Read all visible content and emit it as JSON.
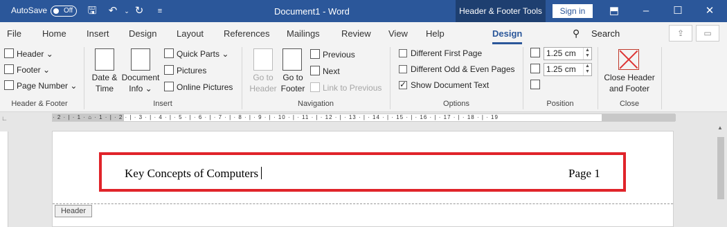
{
  "titlebar": {
    "autosave_label": "AutoSave",
    "autosave_state": "Off",
    "document_title": "Document1  -  Word",
    "context_tools": "Header & Footer Tools",
    "sign_in": "Sign in"
  },
  "tabs": [
    "File",
    "Home",
    "Insert",
    "Design",
    "Layout",
    "References",
    "Mailings",
    "Review",
    "View",
    "Help",
    "Design"
  ],
  "active_tab": "Design",
  "search_label": "Search",
  "ribbon": {
    "header_footer": {
      "header": "Header",
      "footer": "Footer",
      "page_number": "Page Number",
      "label": "Header & Footer"
    },
    "insert": {
      "date_time_1": "Date &",
      "date_time_2": "Time",
      "doc_info_1": "Document",
      "doc_info_2": "Info",
      "quick_parts": "Quick Parts",
      "pictures": "Pictures",
      "online_pictures": "Online Pictures",
      "label": "Insert"
    },
    "navigation": {
      "goto_header_1": "Go to",
      "goto_header_2": "Header",
      "goto_footer_1": "Go to",
      "goto_footer_2": "Footer",
      "previous": "Previous",
      "next": "Next",
      "link_previous": "Link to Previous",
      "label": "Navigation"
    },
    "options": {
      "different_first_page": "Different First Page",
      "different_odd_even": "Different Odd & Even Pages",
      "show_document_text": "Show Document Text",
      "label": "Options"
    },
    "position": {
      "header_from_top": "1.25 cm",
      "footer_from_bottom": "1.25 cm",
      "label": "Position"
    },
    "close": {
      "close_1": "Close Header",
      "close_2": "and Footer",
      "label": "Close"
    }
  },
  "ruler_ticks": "· 2 · | · 1 · ⌂ · 1 · | · 2 · | · 3 · | · 4 · | · 5 · | · 6 · | · 7 · | · 8 · | · 9 · | · 10 · | · 11 · | · 12 · | · 13 · | · 14 · | · 15 · | · 16 · | · 17 · | · 18 · | · 19",
  "document": {
    "header_left": "Key Concepts of Computers",
    "header_right": "Page 1",
    "header_tag": "Header"
  },
  "colors": {
    "word_blue": "#2b579a",
    "highlight_red": "#e0242a"
  }
}
